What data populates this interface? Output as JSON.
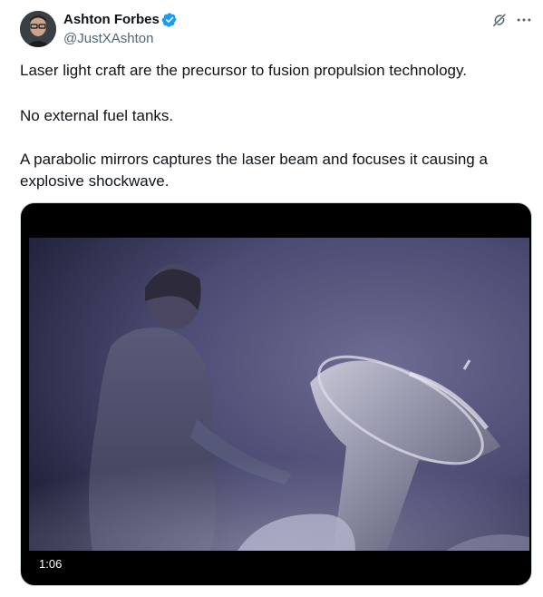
{
  "author": {
    "display_name": "Ashton Forbes",
    "handle": "@JustXAshton",
    "verified": true
  },
  "tweet": {
    "paragraphs": [
      "Laser light craft are the precursor to fusion propulsion technology.",
      "No external fuel tanks.",
      "A parabolic mirrors captures the laser beam and focuses it causing a explosive shockwave."
    ]
  },
  "media": {
    "type": "video",
    "duration": "1:06"
  },
  "colors": {
    "text_primary": "#0f1419",
    "text_secondary": "#536471",
    "verified_badge": "#1d9bf0"
  },
  "icons": {
    "verified": "verified-badge-icon",
    "grok": "grok-icon",
    "more": "more-horizontal-icon"
  }
}
